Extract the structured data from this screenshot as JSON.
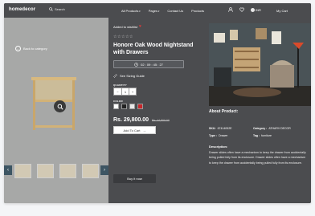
{
  "nav": {
    "logo": "homedecor",
    "search_label": "Search",
    "links": [
      {
        "label": "All Products",
        "dropdown": true
      },
      {
        "label": "Pages",
        "dropdown": true
      },
      {
        "label": "Contact Us",
        "dropdown": false
      },
      {
        "label": "Products",
        "dropdown": false
      }
    ],
    "currency": "INR",
    "cart_label": "My Cart"
  },
  "gallery": {
    "back_label": "Back to category",
    "thumbnail_count": 4
  },
  "product": {
    "wishlist_label": "Added to wishlist",
    "rating_stars": 5,
    "title": "Honore Oak Wood Nightstand with Drawers",
    "timer": "02 : 09 : 45 : 27",
    "sizing_label": "See Sizing Guide",
    "quantity_label": "QUANTITY",
    "quantity_minus": "−",
    "quantity_value": "1",
    "quantity_plus": "+",
    "color_label": "COLOR",
    "colors": [
      "#ffffff",
      "#222222",
      "#e8e8e8",
      "#c8262b"
    ],
    "price": "Rs. 29,800.00",
    "old_price": "Rs. 44,500.00",
    "add_to_cart": "Add To Cart",
    "buy_now": "Buy it now"
  },
  "about": {
    "heading": "About Product:",
    "sku_label": "SKU:",
    "sku_value": "67414052E",
    "category_label": "Category :",
    "category_value": "ATHARV DECOR",
    "type_label": "Type :",
    "type_value": "Drawer",
    "tag_label": "Tag :",
    "tag_value": "furniture",
    "description_heading": "Description:",
    "description": "Drawer slides often have a mechanism to keep the drawer from accidentally being pulled fully from its enclosure. Drawer slides often have a mechanism to keep the drawer from accidentally being pulled fully from its enclosure."
  },
  "colors": {
    "background": "#4b4c4f",
    "gallery_bg": "#a7a8a7",
    "accent_red": "#e23a3a"
  }
}
